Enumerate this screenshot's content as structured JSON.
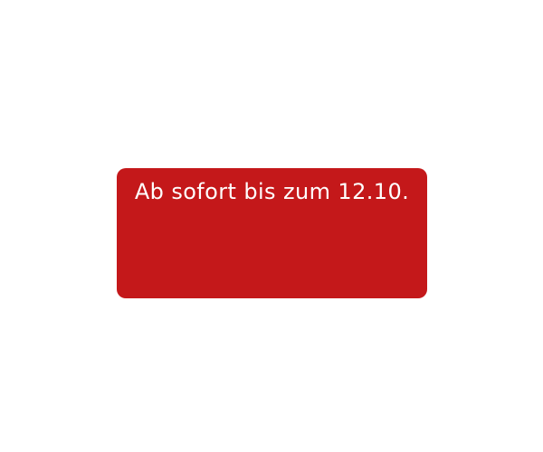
{
  "banner": {
    "text": "Ab sofort bis zum 12.10.",
    "background_color": "#c4181a",
    "text_color": "#ffffff"
  },
  "page": {
    "background_color": "#ffffff"
  }
}
